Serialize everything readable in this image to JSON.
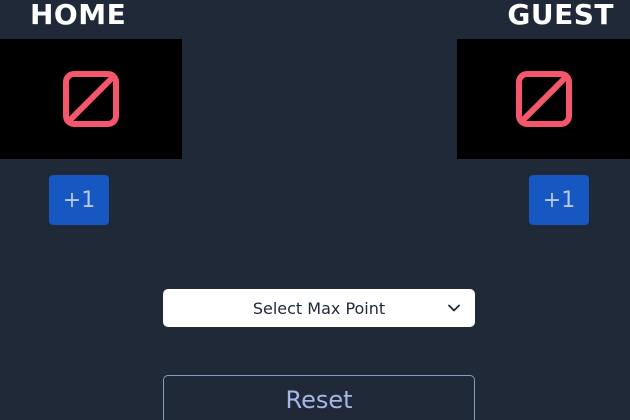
{
  "home": {
    "title": "HOME",
    "increment_label": "+1",
    "score_icon": "null-set-icon"
  },
  "guest": {
    "title": "GUEST",
    "increment_label": "+1",
    "score_icon": "null-set-icon"
  },
  "max_point_select": {
    "selected": "Select Max Point"
  },
  "reset": {
    "label": "Reset"
  },
  "colors": {
    "background": "#1f2937",
    "score_box": "#000000",
    "icon": "#f4566b",
    "plus_button": "#1757c2",
    "reset_text": "#a7b6e6"
  }
}
